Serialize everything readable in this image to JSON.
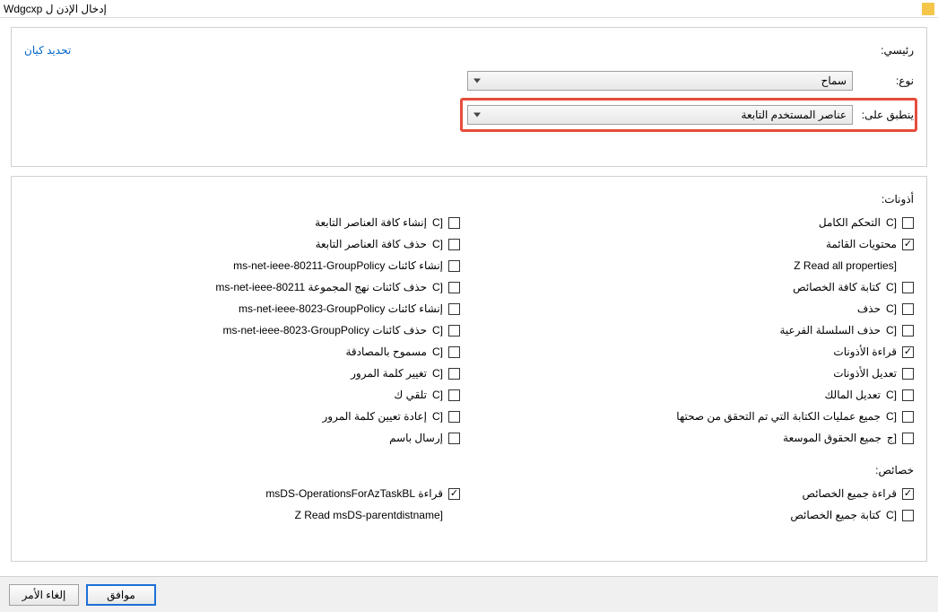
{
  "titlebar": {
    "text": "Wdgcxp إدخال الإذن ل"
  },
  "top": {
    "principal_label": "رئيسي:",
    "select_entity": "تحديد كيان",
    "type_label": "نوع:",
    "type_value": "سماح",
    "applies_label": "ينطبق على:",
    "applies_value": "عناصر المستخدم التابعة"
  },
  "permissions": {
    "title": "أذونات:",
    "left": [
      {
        "prefix": "[C",
        "label": "التحكم الكامل",
        "checked": false
      },
      {
        "prefix": "",
        "label": "محتويات القائمة",
        "checked": true
      },
      {
        "prefix": "",
        "label": "[Z Read all properties",
        "checked": false,
        "noBox": true
      },
      {
        "prefix": "[C",
        "label": "كتابة كافة الخصائص",
        "checked": false
      },
      {
        "prefix": "[C",
        "label": "حذف",
        "checked": false
      },
      {
        "prefix": "[C",
        "label": "حذف السلسلة الفرعية",
        "checked": false
      },
      {
        "prefix": "",
        "label": "قراءة الأذونات",
        "checked": true
      },
      {
        "prefix": "",
        "label": "تعديل الأذونات",
        "checked": false
      },
      {
        "prefix": "[C",
        "label": "تعديل المالك",
        "checked": false
      },
      {
        "prefix": "[C",
        "label": "جميع عمليات الكتابة التي تم التحقق من صحتها",
        "checked": false
      },
      {
        "prefix": "[ج",
        "label": "جميع الحقوق الموسعة",
        "checked": false
      }
    ],
    "right": [
      {
        "prefix": "[C",
        "label": "إنشاء كافة العناصر التابعة",
        "checked": false
      },
      {
        "prefix": "[C",
        "label": "حذف كافة العناصر التابعة",
        "checked": false
      },
      {
        "prefix": "",
        "label": "إنشاء كائنات ms-net-ieee-80211-GroupPolicy",
        "checked": false
      },
      {
        "prefix": "[C",
        "label": "حذف كائنات نهج المجموعة ms-net-ieee-80211",
        "checked": false
      },
      {
        "prefix": "",
        "label": "إنشاء كائنات ms-net-ieee-8023-GroupPolicy",
        "checked": false
      },
      {
        "prefix": "[C",
        "label": "حذف كائنات ms-net-ieee-8023-GroupPolicy",
        "checked": false
      },
      {
        "prefix": "[C",
        "label": "مسموح بالمصادقة",
        "checked": false
      },
      {
        "prefix": "[C",
        "label": "تغيير كلمة المرور",
        "checked": false
      },
      {
        "prefix": "[C",
        "label": "تلقي ك",
        "checked": false
      },
      {
        "prefix": "[C",
        "label": "إعادة تعيين كلمة المرور",
        "checked": false
      },
      {
        "prefix": "",
        "label": "إرسال باسم",
        "checked": false
      }
    ]
  },
  "properties": {
    "title": "خصائص:",
    "left": [
      {
        "prefix": "",
        "label": "قراءة جميع الخصائص",
        "checked": true
      },
      {
        "prefix": "[C",
        "label": "كتابة جميع الخصائص",
        "checked": false
      }
    ],
    "right": [
      {
        "prefix": "",
        "label": "قراءة msDS-OperationsForAzTaskBL",
        "checked": true
      },
      {
        "prefix": "",
        "label": "[Z Read msDS-parentdistname",
        "checked": false,
        "noBox": true
      }
    ]
  },
  "footer": {
    "ok": "موافق",
    "cancel": "إلغاء الأمر"
  }
}
